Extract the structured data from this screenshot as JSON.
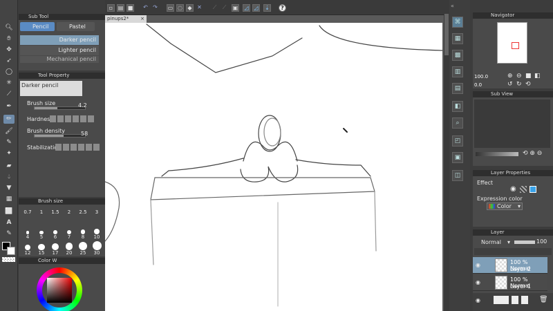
{
  "subtool": {
    "title": "Sub Tool",
    "tabs": [
      "Pencil",
      "Pastel"
    ],
    "brushes": [
      "Darker pencil",
      "Lighter pencil",
      "Mechanical pencil"
    ]
  },
  "tool_property": {
    "title": "Tool Property",
    "preset_name": "Darker pencil",
    "brush_size_label": "Brush size",
    "brush_size_value": "4.2",
    "brush_size_fraction": 0.45,
    "hardness_label": "Hardness",
    "brush_density_label": "Brush density",
    "brush_density_value": "58",
    "brush_density_fraction": 0.58,
    "stabilization_label": "Stabilization"
  },
  "brush_size_panel": {
    "title": "Brush size",
    "sizes": [
      "0.7",
      "1",
      "1.5",
      "2",
      "2.5",
      "3",
      "4",
      "5",
      "6",
      "7",
      "8",
      "10",
      "12",
      "15",
      "17",
      "20",
      "25",
      "30"
    ]
  },
  "color_wheel": {
    "title": "Color W"
  },
  "canvas": {
    "tab_title": "pinups2*"
  },
  "navigator": {
    "title": "Navigator",
    "zoom": "100.0",
    "rotation": "0.0"
  },
  "subview": {
    "title": "Sub View"
  },
  "layer_property": {
    "title": "Layer Properties",
    "effect_label": "Effect",
    "expression_label": "Expression color",
    "expression_value": "Color"
  },
  "layer_panel": {
    "title": "Layer",
    "blend_mode": "Normal",
    "opacity": "100",
    "layers": [
      {
        "opacity": "100 %",
        "mode": "Normal",
        "name": "Layer 2",
        "selected": true
      },
      {
        "opacity": "100 %",
        "mode": "Normal",
        "name": "Layer 1",
        "selected": false
      }
    ]
  },
  "colors": {
    "accent": "#5a8bc4",
    "panel": "#4a4a4a",
    "canvas": "#ffffff",
    "selected_layer": "#7f9fb8"
  }
}
